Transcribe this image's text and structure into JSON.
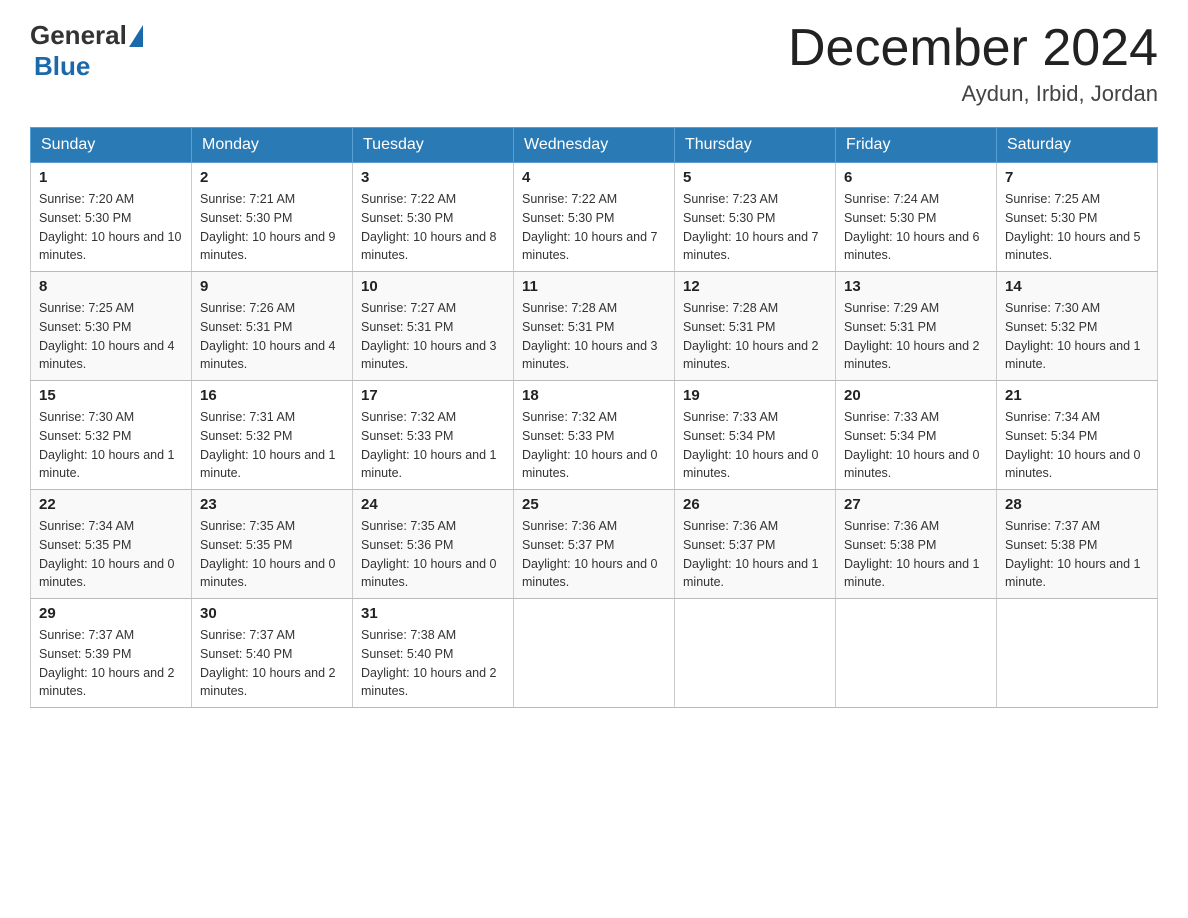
{
  "logo": {
    "general": "General",
    "blue": "Blue"
  },
  "title": "December 2024",
  "location": "Aydun, Irbid, Jordan",
  "days_of_week": [
    "Sunday",
    "Monday",
    "Tuesday",
    "Wednesday",
    "Thursday",
    "Friday",
    "Saturday"
  ],
  "weeks": [
    [
      {
        "day": "1",
        "sunrise": "7:20 AM",
        "sunset": "5:30 PM",
        "daylight": "10 hours and 10 minutes."
      },
      {
        "day": "2",
        "sunrise": "7:21 AM",
        "sunset": "5:30 PM",
        "daylight": "10 hours and 9 minutes."
      },
      {
        "day": "3",
        "sunrise": "7:22 AM",
        "sunset": "5:30 PM",
        "daylight": "10 hours and 8 minutes."
      },
      {
        "day": "4",
        "sunrise": "7:22 AM",
        "sunset": "5:30 PM",
        "daylight": "10 hours and 7 minutes."
      },
      {
        "day": "5",
        "sunrise": "7:23 AM",
        "sunset": "5:30 PM",
        "daylight": "10 hours and 7 minutes."
      },
      {
        "day": "6",
        "sunrise": "7:24 AM",
        "sunset": "5:30 PM",
        "daylight": "10 hours and 6 minutes."
      },
      {
        "day": "7",
        "sunrise": "7:25 AM",
        "sunset": "5:30 PM",
        "daylight": "10 hours and 5 minutes."
      }
    ],
    [
      {
        "day": "8",
        "sunrise": "7:25 AM",
        "sunset": "5:30 PM",
        "daylight": "10 hours and 4 minutes."
      },
      {
        "day": "9",
        "sunrise": "7:26 AM",
        "sunset": "5:31 PM",
        "daylight": "10 hours and 4 minutes."
      },
      {
        "day": "10",
        "sunrise": "7:27 AM",
        "sunset": "5:31 PM",
        "daylight": "10 hours and 3 minutes."
      },
      {
        "day": "11",
        "sunrise": "7:28 AM",
        "sunset": "5:31 PM",
        "daylight": "10 hours and 3 minutes."
      },
      {
        "day": "12",
        "sunrise": "7:28 AM",
        "sunset": "5:31 PM",
        "daylight": "10 hours and 2 minutes."
      },
      {
        "day": "13",
        "sunrise": "7:29 AM",
        "sunset": "5:31 PM",
        "daylight": "10 hours and 2 minutes."
      },
      {
        "day": "14",
        "sunrise": "7:30 AM",
        "sunset": "5:32 PM",
        "daylight": "10 hours and 1 minute."
      }
    ],
    [
      {
        "day": "15",
        "sunrise": "7:30 AM",
        "sunset": "5:32 PM",
        "daylight": "10 hours and 1 minute."
      },
      {
        "day": "16",
        "sunrise": "7:31 AM",
        "sunset": "5:32 PM",
        "daylight": "10 hours and 1 minute."
      },
      {
        "day": "17",
        "sunrise": "7:32 AM",
        "sunset": "5:33 PM",
        "daylight": "10 hours and 1 minute."
      },
      {
        "day": "18",
        "sunrise": "7:32 AM",
        "sunset": "5:33 PM",
        "daylight": "10 hours and 0 minutes."
      },
      {
        "day": "19",
        "sunrise": "7:33 AM",
        "sunset": "5:34 PM",
        "daylight": "10 hours and 0 minutes."
      },
      {
        "day": "20",
        "sunrise": "7:33 AM",
        "sunset": "5:34 PM",
        "daylight": "10 hours and 0 minutes."
      },
      {
        "day": "21",
        "sunrise": "7:34 AM",
        "sunset": "5:34 PM",
        "daylight": "10 hours and 0 minutes."
      }
    ],
    [
      {
        "day": "22",
        "sunrise": "7:34 AM",
        "sunset": "5:35 PM",
        "daylight": "10 hours and 0 minutes."
      },
      {
        "day": "23",
        "sunrise": "7:35 AM",
        "sunset": "5:35 PM",
        "daylight": "10 hours and 0 minutes."
      },
      {
        "day": "24",
        "sunrise": "7:35 AM",
        "sunset": "5:36 PM",
        "daylight": "10 hours and 0 minutes."
      },
      {
        "day": "25",
        "sunrise": "7:36 AM",
        "sunset": "5:37 PM",
        "daylight": "10 hours and 0 minutes."
      },
      {
        "day": "26",
        "sunrise": "7:36 AM",
        "sunset": "5:37 PM",
        "daylight": "10 hours and 1 minute."
      },
      {
        "day": "27",
        "sunrise": "7:36 AM",
        "sunset": "5:38 PM",
        "daylight": "10 hours and 1 minute."
      },
      {
        "day": "28",
        "sunrise": "7:37 AM",
        "sunset": "5:38 PM",
        "daylight": "10 hours and 1 minute."
      }
    ],
    [
      {
        "day": "29",
        "sunrise": "7:37 AM",
        "sunset": "5:39 PM",
        "daylight": "10 hours and 2 minutes."
      },
      {
        "day": "30",
        "sunrise": "7:37 AM",
        "sunset": "5:40 PM",
        "daylight": "10 hours and 2 minutes."
      },
      {
        "day": "31",
        "sunrise": "7:38 AM",
        "sunset": "5:40 PM",
        "daylight": "10 hours and 2 minutes."
      },
      null,
      null,
      null,
      null
    ]
  ]
}
